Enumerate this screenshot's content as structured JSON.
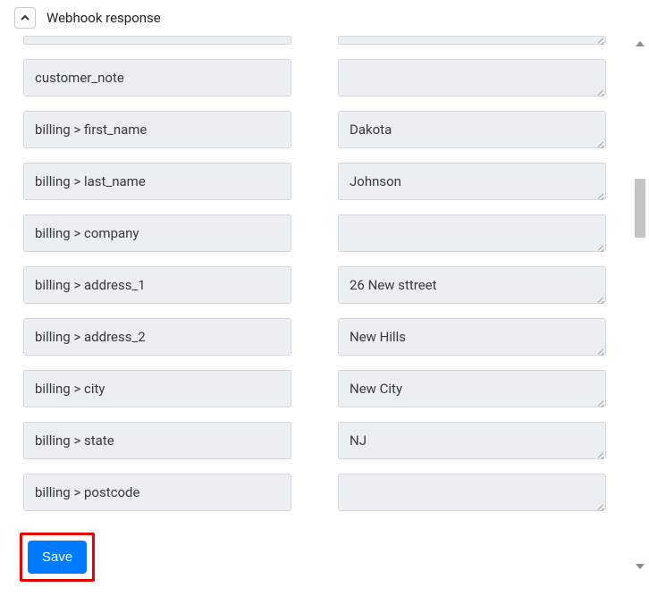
{
  "header": {
    "title": "Webhook response"
  },
  "rows": [
    {
      "key": "customer_note",
      "value": ""
    },
    {
      "key": "billing > first_name",
      "value": "Dakota"
    },
    {
      "key": "billing > last_name",
      "value": "Johnson"
    },
    {
      "key": "billing > company",
      "value": ""
    },
    {
      "key": "billing > address_1",
      "value": "26 New sttreet"
    },
    {
      "key": "billing > address_2",
      "value": "New Hills"
    },
    {
      "key": "billing > city",
      "value": "New City"
    },
    {
      "key": "billing > state",
      "value": "NJ"
    },
    {
      "key": "billing > postcode",
      "value": ""
    }
  ],
  "actions": {
    "save_label": "Save"
  }
}
